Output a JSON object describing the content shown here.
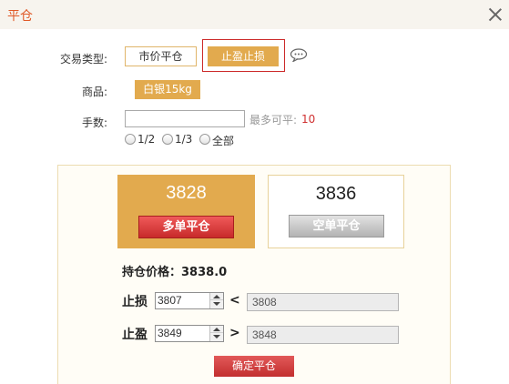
{
  "window": {
    "title": "平仓"
  },
  "form": {
    "trade_type_label": "交易类型:",
    "trade_types": [
      "市价平仓",
      "止盈止损"
    ],
    "product_label": "商品:",
    "product_value": "白银15kg",
    "quantity_label": "手数:",
    "quantity_value": "",
    "max_label": "最多可平:",
    "max_value": "10",
    "ratio_options": [
      "1/2",
      "1/3",
      "全部"
    ]
  },
  "orders": {
    "long_price": "3828",
    "long_button": "多单平仓",
    "short_price": "3836",
    "short_button": "空单平仓"
  },
  "position": {
    "hold_label": "持仓价格：",
    "hold_price": "3838.0",
    "stop_loss_label": "止损",
    "stop_loss_value": "3807",
    "stop_loss_op": "<",
    "stop_loss_ref": "3808",
    "take_profit_label": "止盈",
    "take_profit_value": "3849",
    "take_profit_op": ">",
    "take_profit_ref": "3848"
  },
  "actions": {
    "confirm": "确定平仓"
  },
  "colors": {
    "accent": "#e2aa4e",
    "title": "#e05a28",
    "danger": "#c72a2a"
  }
}
